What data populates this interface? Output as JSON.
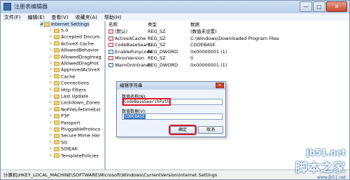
{
  "window": {
    "title": "注册表编辑器",
    "minimize": "—",
    "maximize": "□",
    "close": "✕"
  },
  "menu": [
    "文件(F)",
    "编辑(E)",
    "查看(V)",
    "收藏夹(A)",
    "帮助(H)"
  ],
  "tree": {
    "root": "Internet Settings",
    "children": [
      "5.0",
      "Accepted Docum",
      "ActiveX Cache",
      "AllowedBehavior",
      "AllowedDragImag",
      "AllowedDragProt",
      "ApprovedActiveX",
      "Cache",
      "Connections",
      "Http Filters",
      "Last Update",
      "Lockdown_Zones",
      "NoFileLifetimeExt",
      "P3P",
      "Passport",
      "PluggableProtoco",
      "Secure Mime Har",
      "SO",
      "SOIEAK",
      "TemplatePolicies"
    ]
  },
  "values_table": {
    "headers": [
      "名称",
      "类型",
      "数据"
    ],
    "rows": [
      {
        "name": "(默认)",
        "type": "REG_SZ",
        "data": "(数值未设置)",
        "kind": "str"
      },
      {
        "name": "ActiveXCache",
        "type": "REG_SZ",
        "data": "C:\\Windows\\Downloaded Program Files",
        "kind": "str"
      },
      {
        "name": "CodeBaseSearc...",
        "type": "REG_SZ",
        "data": "CODEBASE",
        "kind": "str"
      },
      {
        "name": "EnablePunycode",
        "type": "REG_DWORD",
        "data": "0x00000001 (1)",
        "kind": "bin"
      },
      {
        "name": "MinorVersion",
        "type": "REG_SZ",
        "data": "0",
        "kind": "str"
      },
      {
        "name": "WarnOnIntranet",
        "type": "REG_DWORD",
        "data": "0x00000001 (1)",
        "kind": "bin"
      }
    ]
  },
  "status": "计算机\\HKEY_LOCAL_MACHINE\\SOFTWARE\\Microsoft\\Windows\\CurrentVersion\\Internet Settings",
  "dialog": {
    "title": "编辑字符串",
    "close": "✕",
    "name_label": "数值名称(N):",
    "name_value": "CodeBaseSearchPath",
    "data_label": "数值数据(V):",
    "data_value": "CODEBASE",
    "ok": "确定",
    "cancel": "取消"
  },
  "watermark": {
    "line1": "jb51.net",
    "line2": "脚本之家",
    "line3": "www.jb51.net"
  }
}
